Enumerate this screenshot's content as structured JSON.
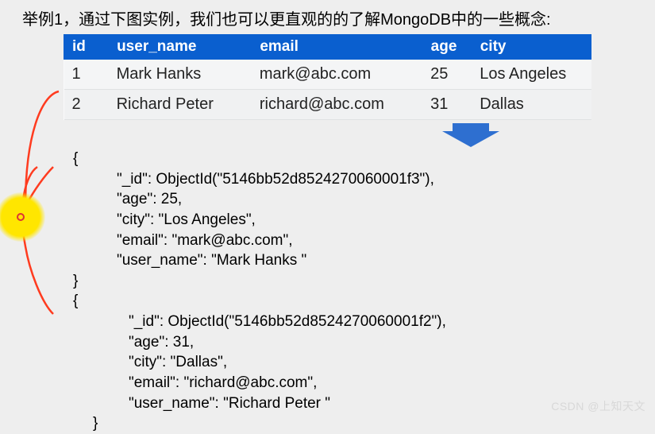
{
  "caption": "举例1，通过下图实例，我们也可以更直观的的了解MongoDB中的一些概念:",
  "table": {
    "headers": [
      "id",
      "user_name",
      "email",
      "age",
      "city"
    ],
    "rows": [
      {
        "id": "1",
        "user_name": "Mark Hanks",
        "email": "mark@abc.com",
        "age": "25",
        "city": "Los Angeles"
      },
      {
        "id": "2",
        "user_name": "Richard Peter",
        "email": "richard@abc.com",
        "age": "31",
        "city": "Dallas"
      }
    ]
  },
  "documents": [
    {
      "open": "{",
      "lines": [
        "\"_id\": ObjectId(\"5146bb52d8524270060001f3\"),",
        "\"age\": 25,",
        "\"city\": \"Los Angeles\",",
        "\"email\": \"mark@abc.com\",",
        "\"user_name\": \"Mark Hanks \""
      ],
      "close": "}"
    },
    {
      "open": "{",
      "lines": [
        "\"_id\": ObjectId(\"5146bb52d8524270060001f2\"),",
        "\"age\": 31,",
        "\"city\": \"Dallas\",",
        "\"email\": \"richard@abc.com\",",
        "\"user_name\": \"Richard Peter \""
      ],
      "close": "}"
    }
  ],
  "watermark": "CSDN @上知天文"
}
